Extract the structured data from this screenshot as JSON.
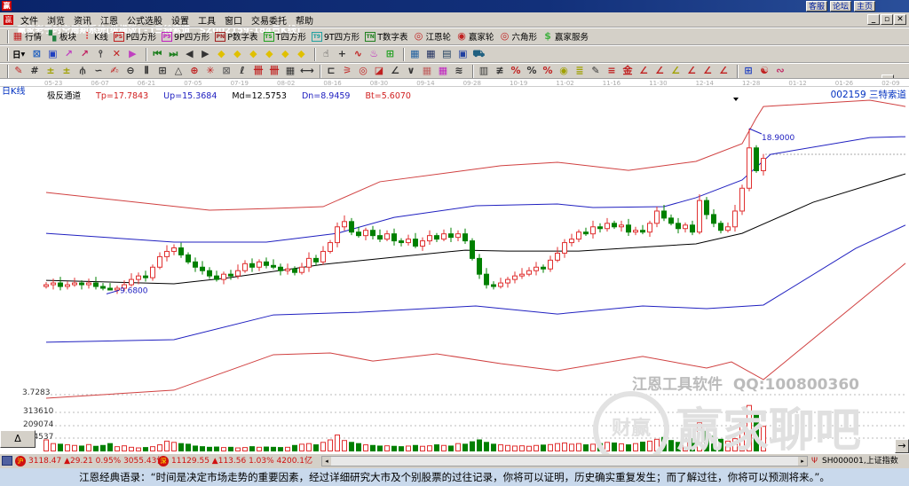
{
  "window": {
    "title": "赢家老子时空周期系统[纵横版] - [三特索道   SZ002159-184日K线]",
    "app_icon": "赢",
    "links": [
      "客服",
      "论坛",
      "主页"
    ],
    "controls": [
      "_",
      "🗗",
      "✕"
    ]
  },
  "menu": [
    "文件",
    "浏览",
    "资讯",
    "江恩",
    "公式选股",
    "设置",
    "工具",
    "窗口",
    "交易委托",
    "帮助"
  ],
  "toolbar1": [
    {
      "icon": "grid-icon",
      "glyph": "▦",
      "label": "行情"
    },
    {
      "icon": "blocks-icon",
      "glyph": "▚",
      "label": "板块"
    },
    {
      "icon": "kline-icon",
      "glyph": "⫶",
      "label": "K线"
    },
    {
      "icon": "PS",
      "label": "P四方形"
    },
    {
      "icon": "P9",
      "label": "9P四方形"
    },
    {
      "icon": "PN",
      "label": "P数字表"
    },
    {
      "icon": "TS",
      "label": "T四方形"
    },
    {
      "icon": "T9",
      "label": "9T四方形"
    },
    {
      "icon": "TN",
      "label": "T数字表"
    },
    {
      "icon": "wheel-icon",
      "glyph": "◎",
      "label": "江恩轮"
    },
    {
      "icon": "wheel-icon",
      "glyph": "◉",
      "label": "赢家轮"
    },
    {
      "icon": "hexagon-icon",
      "glyph": "◎",
      "label": "六角形"
    },
    {
      "icon": "dollar-icon",
      "glyph": "$",
      "label": "赢家服务"
    }
  ],
  "toolbar2_period": "日",
  "dates": [
    "05-23",
    "06-07",
    "06-21",
    "07-05",
    "07-19",
    "08-02",
    "08-16",
    "08-30",
    "09-14",
    "09-28",
    "10-19",
    "11-02",
    "11-16",
    "11-30",
    "12-14",
    "12-28",
    "01-12",
    "01-26",
    "02-09"
  ],
  "chart_header": {
    "period_label": "日K线",
    "indicator": "极反通道",
    "tp": "Tp=17.7843",
    "up": "Up=15.3684",
    "md": "Md=12.5753",
    "dn": "Dn=8.9459",
    "bt": "Bt=5.6070",
    "stock": "002159  三特索道"
  },
  "colors": {
    "up": "#e03030",
    "down": "#008000",
    "red_band": "#d04040",
    "blue_band": "#2020c0",
    "mid": "#000000"
  },
  "chart_data": {
    "type": "candlestick",
    "high_label": "18.9000",
    "low_label": "9.6800",
    "high_value": 18.9,
    "high_index": 99,
    "low_value": 9.68,
    "low_index": 9,
    "close": [
      10.0,
      10.1,
      9.9,
      10.0,
      10.1,
      10.0,
      10.1,
      9.9,
      9.8,
      9.7,
      9.8,
      10.0,
      10.3,
      10.5,
      10.4,
      11.0,
      11.6,
      11.9,
      12.1,
      11.7,
      11.3,
      11.0,
      10.8,
      10.5,
      10.3,
      10.6,
      10.5,
      10.8,
      11.2,
      11.0,
      11.3,
      11.1,
      11.0,
      10.8,
      10.9,
      10.7,
      11.0,
      11.5,
      11.3,
      11.9,
      12.4,
      13.3,
      13.6,
      13.0,
      12.8,
      13.1,
      12.8,
      12.6,
      12.9,
      12.5,
      12.4,
      12.6,
      12.2,
      12.5,
      12.8,
      12.6,
      12.9,
      12.7,
      12.9,
      12.5,
      11.5,
      10.6,
      10.0,
      9.9,
      10.1,
      10.3,
      10.5,
      10.6,
      10.8,
      11.0,
      10.9,
      11.4,
      11.8,
      12.4,
      12.6,
      13.0,
      12.9,
      13.3,
      13.2,
      13.5,
      13.3,
      13.4,
      13.0,
      13.1,
      13.0,
      13.5,
      14.2,
      13.8,
      13.5,
      13.2,
      13.4,
      13.0,
      14.8,
      14.0,
      13.5,
      13.1,
      13.3,
      14.2,
      15.5,
      17.8,
      16.5,
      17.2
    ],
    "volume": [
      90000,
      60000,
      55000,
      50000,
      45000,
      40000,
      52000,
      38000,
      45000,
      60000,
      35000,
      42000,
      30000,
      25000,
      28000,
      35000,
      50000,
      80000,
      70000,
      60000,
      55000,
      40000,
      35000,
      30000,
      32000,
      28000,
      30000,
      25000,
      28000,
      35000,
      30000,
      32000,
      30000,
      28000,
      30000,
      45000,
      55000,
      60000,
      50000,
      70000,
      90000,
      130000,
      85000,
      70000,
      60000,
      50000,
      45000,
      40000,
      42000,
      38000,
      35000,
      40000,
      45000,
      38000,
      42000,
      50000,
      45000,
      40000,
      60000,
      55000,
      75000,
      90000,
      70000,
      55000,
      50000,
      45000,
      40000,
      42000,
      38000,
      45000,
      48000,
      52000,
      60000,
      65000,
      55000,
      60000,
      50000,
      55000,
      60000,
      70000,
      65000,
      58000,
      50000,
      60000,
      72000,
      80000,
      95000,
      110000,
      85000,
      70000,
      90000,
      100000,
      230000,
      160000,
      120000,
      95000,
      80000,
      100000,
      260000,
      370000,
      300000,
      200000
    ],
    "bands": {
      "top_red": [
        [
          0,
          15.26
        ],
        [
          23,
          14.25
        ],
        [
          32,
          14.35
        ],
        [
          39,
          14.45
        ],
        [
          47,
          15.87
        ],
        [
          64,
          16.78
        ],
        [
          72,
          16.98
        ],
        [
          82,
          16.52
        ],
        [
          91.5,
          17.03
        ],
        [
          98,
          18.04
        ],
        [
          100,
          19.51
        ],
        [
          101,
          20.16
        ],
        [
          116,
          20.52
        ],
        [
          121,
          20.16
        ]
      ],
      "upper_blue": [
        [
          0,
          12.93
        ],
        [
          18,
          12.43
        ],
        [
          31,
          12.43
        ],
        [
          41,
          12.93
        ],
        [
          49,
          13.84
        ],
        [
          60.5,
          14.5
        ],
        [
          72,
          14.6
        ],
        [
          77,
          14.4
        ],
        [
          87,
          14.45
        ],
        [
          91.5,
          14.96
        ],
        [
          98,
          15.97
        ],
        [
          102,
          17.43
        ],
        [
          116,
          18.39
        ],
        [
          121,
          18.44
        ]
      ],
      "middle": [
        [
          0,
          10.25
        ],
        [
          18,
          10.05
        ],
        [
          26,
          10.41
        ],
        [
          39,
          11.16
        ],
        [
          49,
          11.57
        ],
        [
          59,
          11.97
        ],
        [
          65,
          11.92
        ],
        [
          75,
          11.92
        ],
        [
          91.5,
          12.33
        ],
        [
          98,
          12.93
        ],
        [
          108,
          14.7
        ],
        [
          121,
          16.32
        ]
      ],
      "lower_blue": [
        [
          0,
          6.72
        ],
        [
          18,
          6.87
        ],
        [
          32,
          8.28
        ],
        [
          44,
          8.43
        ],
        [
          60.5,
          8.79
        ],
        [
          72,
          8.33
        ],
        [
          84,
          8.79
        ],
        [
          93,
          8.64
        ],
        [
          101,
          8.84
        ],
        [
          114,
          12.07
        ],
        [
          121,
          13.4
        ]
      ],
      "bottom_red": [
        [
          0,
          3.53
        ],
        [
          18,
          3.99
        ],
        [
          32,
          6.01
        ],
        [
          40,
          6.11
        ],
        [
          46,
          5.65
        ],
        [
          55,
          6.06
        ],
        [
          64,
          5.5
        ],
        [
          72,
          5.1
        ],
        [
          84,
          5.91
        ],
        [
          93,
          5.25
        ],
        [
          96.5,
          5.6
        ],
        [
          101,
          4.59
        ],
        [
          121,
          11.22
        ]
      ]
    },
    "price_axis_label": "3.7283",
    "volume_ticks": [
      "313610",
      "209074",
      "104537"
    ],
    "volume_tick_values": [
      313610,
      209074,
      104537
    ]
  },
  "watermark": {
    "line1": "江恩工具软件  QQ:100800360",
    "line2": "赢家聊吧",
    "logo": "财赢"
  },
  "volume_toggle": "Δ",
  "status": {
    "sh": "沪",
    "sh_quote": "3118.47 ▲29.21 0.95% 3055.43亿",
    "sz": "深",
    "sz_quote": "11129.55 ▲113.56 1.03% 4200.1亿",
    "index": "SH000001,上证指数"
  },
  "quote": "江恩经典语录：“时间是决定市场走势的重要因素，经过详细研究大市及个别股票的过往记录，你将可以证明，历史确实重复发生；而了解过往，你将可以预测将来。”。"
}
